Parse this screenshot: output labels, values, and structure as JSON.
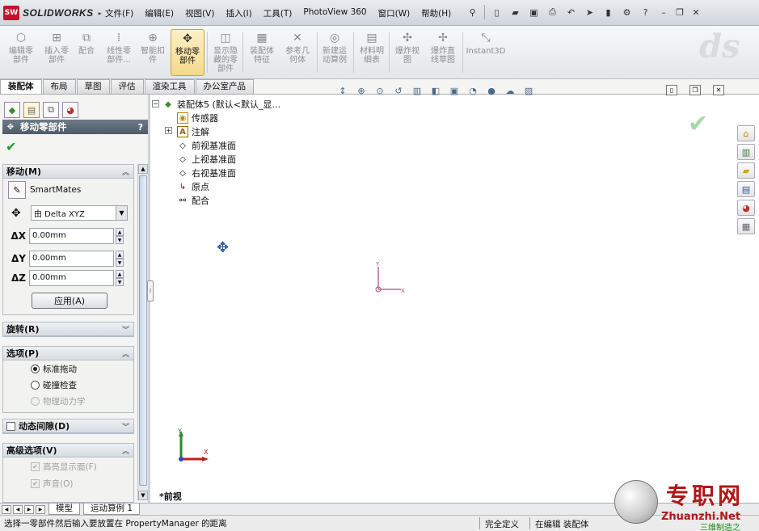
{
  "app": {
    "brand": "SOLIDWORKS",
    "logo_mark": "SW"
  },
  "menu": [
    "文件(F)",
    "编辑(E)",
    "视图(V)",
    "插入(I)",
    "工具(T)",
    "PhotoView 360",
    "窗口(W)",
    "帮助(H)"
  ],
  "commands": [
    {
      "label": "编辑零\n部件",
      "icon": "edit-component-icon"
    },
    {
      "label": "插入零\n部件",
      "icon": "insert-component-icon"
    },
    {
      "label": "配合",
      "icon": "mate-icon"
    },
    {
      "label": "线性零\n部件...",
      "icon": "linear-pattern-icon"
    },
    {
      "label": "智能扣\n件",
      "icon": "smart-fastener-icon"
    },
    {
      "label": "移动零\n部件",
      "icon": "move-component-icon",
      "active": true
    },
    {
      "label": "显示隐\n藏的零\n部件",
      "icon": "show-hidden-icon"
    },
    {
      "label": "装配体\n特征",
      "icon": "assembly-feature-icon"
    },
    {
      "label": "参考几\n何体",
      "icon": "reference-geometry-icon"
    },
    {
      "label": "新建运\n动算例",
      "icon": "new-motion-study-icon"
    },
    {
      "label": "材料明\n细表",
      "icon": "bom-icon"
    },
    {
      "label": "爆炸视\n图",
      "icon": "exploded-view-icon"
    },
    {
      "label": "爆炸直\n线草图",
      "icon": "explode-line-sketch-icon"
    },
    {
      "label": "Instant3D",
      "icon": "instant3d-icon"
    }
  ],
  "tabs": [
    "装配体",
    "布局",
    "草图",
    "评估",
    "渲染工具",
    "办公室产品"
  ],
  "property_manager": {
    "title": "移动零部件",
    "help": "?",
    "move_group": {
      "title": "移动(M)",
      "smartmates": "SmartMates",
      "mode": "由 Delta XYZ",
      "dx_label": "ΔX",
      "dx": "0.00mm",
      "dy_label": "ΔY",
      "dy": "0.00mm",
      "dz_label": "ΔZ",
      "dz": "0.00mm",
      "apply": "应用(A)"
    },
    "rotate_group": {
      "title": "旋转(R)"
    },
    "options_group": {
      "title": "选项(P)",
      "opt1": "标准拖动",
      "opt2": "碰撞检查",
      "opt3": "物理动力学"
    },
    "dynamic_clearance": {
      "title": "动态间隙(D)"
    },
    "advanced_group": {
      "title": "高级选项(V)",
      "a1": "高亮显示面(F)",
      "a2": "声音(O)"
    }
  },
  "tree": {
    "root": "装配体5  (默认<默认_显...",
    "items": [
      "传感器",
      "注解",
      "前视基准面",
      "上视基准面",
      "右视基准面",
      "原点",
      "配合"
    ]
  },
  "graphics": {
    "view_label": "*前视",
    "axis_x": "X",
    "axis_y": "Y"
  },
  "bottom_tabs": [
    "模型",
    "运动算例 1"
  ],
  "status": {
    "message": "选择一零部件然后输入要放置在 PropertyManager 的距离",
    "state": "完全定义",
    "editing": "在编辑 装配体"
  },
  "watermark": {
    "cn": "专职网",
    "en": "Zhuanzhi.Net",
    "sub": "三维制造之"
  }
}
